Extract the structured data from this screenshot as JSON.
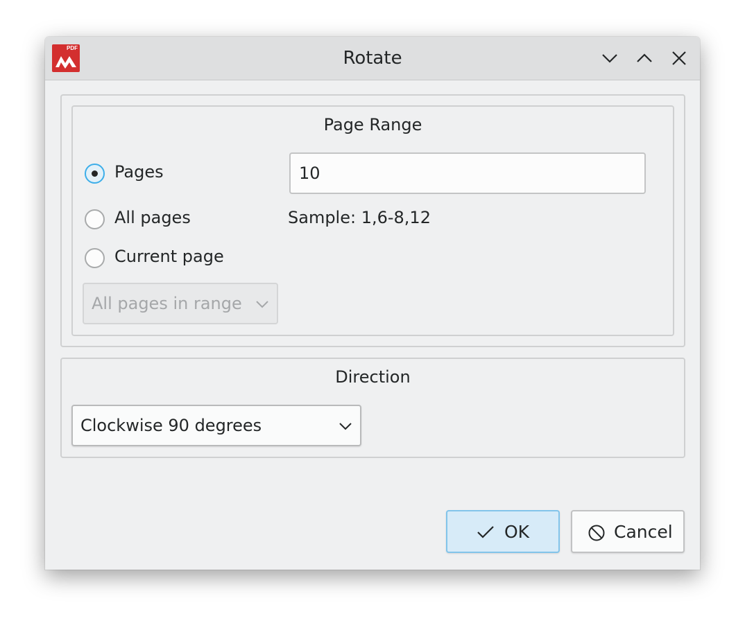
{
  "window": {
    "title": "Rotate",
    "app_icon": "pdf-app-logo",
    "app_icon_text": "PDF",
    "controls": [
      "minimize-icon",
      "maximize-icon",
      "close-icon"
    ]
  },
  "page_range": {
    "title": "Page Range",
    "options": [
      {
        "label": "Pages",
        "checked": true
      },
      {
        "label": "All pages",
        "checked": false
      },
      {
        "label": "Current page",
        "checked": false
      }
    ],
    "pages_input_value": "10",
    "sample_text": "Sample: 1,6-8,12",
    "subset_combo": {
      "value": "All pages in range",
      "enabled": false
    }
  },
  "direction": {
    "title": "Direction",
    "combo": {
      "value": "Clockwise 90 degrees",
      "enabled": true
    }
  },
  "buttons": {
    "ok_label": "OK",
    "cancel_label": "Cancel"
  },
  "colors": {
    "accent": "#3daee9",
    "logo_red": "#d32f2f",
    "ok_button_bg": "#d7ebf8"
  }
}
